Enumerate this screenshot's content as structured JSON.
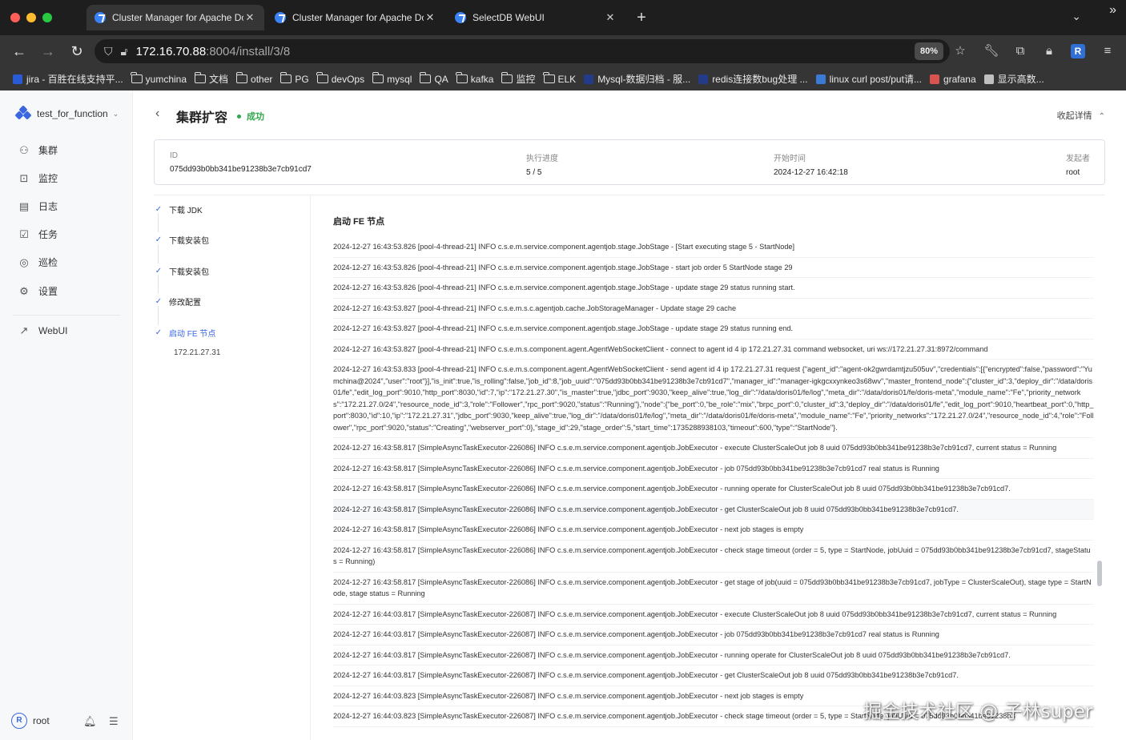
{
  "browser": {
    "tabs": [
      {
        "title": "Cluster Manager for Apache Doris",
        "active": true
      },
      {
        "title": "Cluster Manager for Apache Doris",
        "active": false
      },
      {
        "title": "SelectDB WebUI",
        "active": false
      }
    ],
    "new_tab": "+",
    "tab_menu": "⌄",
    "url_host": "172.16.70.88",
    "url_rest": ":8004/install/3/8",
    "zoom": "80%",
    "profile_initial": "R",
    "bookmarks": [
      {
        "label": "jira - 百胜在线支持平...",
        "kind": "site",
        "color": "#2a5bd7"
      },
      {
        "label": "yumchina",
        "kind": "folder"
      },
      {
        "label": "文档",
        "kind": "folder"
      },
      {
        "label": "other",
        "kind": "folder"
      },
      {
        "label": "PG",
        "kind": "folder"
      },
      {
        "label": "devOps",
        "kind": "folder"
      },
      {
        "label": "mysql",
        "kind": "folder"
      },
      {
        "label": "QA",
        "kind": "folder"
      },
      {
        "label": "kafka",
        "kind": "folder"
      },
      {
        "label": "监控",
        "kind": "folder"
      },
      {
        "label": "ELK",
        "kind": "folder"
      },
      {
        "label": "Mysql-数据归档 - 服...",
        "kind": "site",
        "color": "#243b8a"
      },
      {
        "label": "redis连接数bug处理 ...",
        "kind": "site",
        "color": "#243b8a"
      },
      {
        "label": "linux curl post/put请...",
        "kind": "site",
        "color": "#3a7bd5"
      },
      {
        "label": "grafana",
        "kind": "site",
        "color": "#d9534f"
      },
      {
        "label": "显示高数...",
        "kind": "site",
        "color": "#c0c0c0"
      }
    ],
    "bookmarks_more": "»"
  },
  "sidebar": {
    "workspace": "test_for_function",
    "items": [
      {
        "label": "集群",
        "icon": "cluster-icon",
        "glyph": "⚇"
      },
      {
        "label": "监控",
        "icon": "monitor-icon",
        "glyph": "⊡"
      },
      {
        "label": "日志",
        "icon": "log-icon",
        "glyph": "▤"
      },
      {
        "label": "任务",
        "icon": "task-icon",
        "glyph": "☑"
      },
      {
        "label": "巡检",
        "icon": "inspection-icon",
        "glyph": "◎"
      },
      {
        "label": "设置",
        "icon": "settings-icon",
        "glyph": "⚙"
      }
    ],
    "extra_item": {
      "label": "WebUI",
      "icon": "external-link-icon",
      "glyph": "↗"
    },
    "user": {
      "initial": "R",
      "name": "root"
    }
  },
  "header": {
    "title": "集群扩容",
    "status": "成功",
    "status_color": "#2ea84b",
    "collapse_label": "收起详情"
  },
  "info": {
    "id_label": "ID",
    "id_value": "075dd93b0bb341be91238b3e7cb91cd7",
    "progress_label": "执行进度",
    "progress_value": "5 / 5",
    "start_label": "开始时间",
    "start_value": "2024-12-27 16:42:18",
    "initiator_label": "发起者",
    "initiator_value": "root"
  },
  "steps": [
    {
      "label": "下载 JDK",
      "active": false
    },
    {
      "label": "下载安装包",
      "active": false
    },
    {
      "label": "下载安装包",
      "active": false
    },
    {
      "label": "修改配置",
      "active": false
    },
    {
      "label": "启动 FE 节点",
      "active": true
    }
  ],
  "step_node": "172.21.27.31",
  "log_title": "启动 FE 节点",
  "log_lines": [
    "2024-12-27 16:43:53.826 [pool-4-thread-21] INFO  c.s.e.m.service.component.agentjob.stage.JobStage - [Start executing stage 5 - StartNode]",
    "2024-12-27 16:43:53.826 [pool-4-thread-21] INFO  c.s.e.m.service.component.agentjob.stage.JobStage - start job order 5 StartNode stage 29",
    "2024-12-27 16:43:53.826 [pool-4-thread-21] INFO  c.s.e.m.service.component.agentjob.stage.JobStage - update stage 29 status running start.",
    "2024-12-27 16:43:53.827 [pool-4-thread-21] INFO  c.s.e.m.s.c.agentjob.cache.JobStorageManager - Update stage 29 cache",
    "2024-12-27 16:43:53.827 [pool-4-thread-21] INFO  c.s.e.m.service.component.agentjob.stage.JobStage - update stage 29 status running end.",
    "2024-12-27 16:43:53.827 [pool-4-thread-21] INFO  c.s.e.m.s.component.agent.AgentWebSocketClient - connect to agent id 4 ip 172.21.27.31 command websocket, uri ws://172.21.27.31:8972/command",
    "2024-12-27 16:43:53.833 [pool-4-thread-21] INFO  c.s.e.m.s.component.agent.AgentWebSocketClient - send agent id 4 ip 172.21.27.31 request {\"agent_id\":\"agent-ok2gwrdamtjzu505uv\",\"credentials\":[{\"encrypted\":false,\"password\":\"Yumchina@2024\",\"user\":\"root\"}],\"is_init\":true,\"is_rolling\":false,\"job_id\":8,\"job_uuid\":\"075dd93b0bb341be91238b3e7cb91cd7\",\"manager_id\":\"manager-igkgcxxynkeo3s68wv\",\"master_frontend_node\":{\"cluster_id\":3,\"deploy_dir\":\"/data/doris01/fe\",\"edit_log_port\":9010,\"http_port\":8030,\"id\":7,\"ip\":\"172.21.27.30\",\"is_master\":true,\"jdbc_port\":9030,\"keep_alive\":true,\"log_dir\":\"/data/doris01/fe/log\",\"meta_dir\":\"/data/doris01/fe/doris-meta\",\"module_name\":\"Fe\",\"priority_networks\":\"172.21.27.0/24\",\"resource_node_id\":3,\"role\":\"Follower\",\"rpc_port\":9020,\"status\":\"Running\"},\"node\":{\"be_port\":0,\"be_role\":\"mix\",\"brpc_port\":0,\"cluster_id\":3,\"deploy_dir\":\"/data/doris01/fe\",\"edit_log_port\":9010,\"heartbeat_port\":0,\"http_port\":8030,\"id\":10,\"ip\":\"172.21.27.31\",\"jdbc_port\":9030,\"keep_alive\":true,\"log_dir\":\"/data/doris01/fe/log\",\"meta_dir\":\"/data/doris01/fe/doris-meta\",\"module_name\":\"Fe\",\"priority_networks\":\"172.21.27.0/24\",\"resource_node_id\":4,\"role\":\"Follower\",\"rpc_port\":9020,\"status\":\"Creating\",\"webserver_port\":0},\"stage_id\":29,\"stage_order\":5,\"start_time\":1735288938103,\"timeout\":600,\"type\":\"StartNode\"}.",
    "2024-12-27 16:43:58.817 [SimpleAsyncTaskExecutor-226086] INFO  c.s.e.m.service.component.agentjob.JobExecutor - execute ClusterScaleOut job 8 uuid 075dd93b0bb341be91238b3e7cb91cd7, current status = Running",
    "2024-12-27 16:43:58.817 [SimpleAsyncTaskExecutor-226086] INFO  c.s.e.m.service.component.agentjob.JobExecutor - job 075dd93b0bb341be91238b3e7cb91cd7 real status is Running",
    "2024-12-27 16:43:58.817 [SimpleAsyncTaskExecutor-226086] INFO  c.s.e.m.service.component.agentjob.JobExecutor - running operate for ClusterScaleOut job 8 uuid 075dd93b0bb341be91238b3e7cb91cd7.",
    "2024-12-27 16:43:58.817 [SimpleAsyncTaskExecutor-226086] INFO  c.s.e.m.service.component.agentjob.JobExecutor - get ClusterScaleOut job 8 uuid 075dd93b0bb341be91238b3e7cb91cd7.",
    "2024-12-27 16:43:58.817 [SimpleAsyncTaskExecutor-226086] INFO  c.s.e.m.service.component.agentjob.JobExecutor - next job stages is empty",
    "2024-12-27 16:43:58.817 [SimpleAsyncTaskExecutor-226086] INFO  c.s.e.m.service.component.agentjob.JobExecutor - check stage timeout (order = 5, type = StartNode, jobUuid = 075dd93b0bb341be91238b3e7cb91cd7, stageStatus = Running)",
    "2024-12-27 16:43:58.817 [SimpleAsyncTaskExecutor-226086] INFO  c.s.e.m.service.component.agentjob.JobExecutor - get stage of job(uuid = 075dd93b0bb341be91238b3e7cb91cd7, jobType = ClusterScaleOut), stage type = StartNode, stage status = Running",
    "2024-12-27 16:44:03.817 [SimpleAsyncTaskExecutor-226087] INFO  c.s.e.m.service.component.agentjob.JobExecutor - execute ClusterScaleOut job 8 uuid 075dd93b0bb341be91238b3e7cb91cd7, current status = Running",
    "2024-12-27 16:44:03.817 [SimpleAsyncTaskExecutor-226087] INFO  c.s.e.m.service.component.agentjob.JobExecutor - job 075dd93b0bb341be91238b3e7cb91cd7 real status is Running",
    "2024-12-27 16:44:03.817 [SimpleAsyncTaskExecutor-226087] INFO  c.s.e.m.service.component.agentjob.JobExecutor - running operate for ClusterScaleOut job 8 uuid 075dd93b0bb341be91238b3e7cb91cd7.",
    "2024-12-27 16:44:03.817 [SimpleAsyncTaskExecutor-226087] INFO  c.s.e.m.service.component.agentjob.JobExecutor - get ClusterScaleOut job 8 uuid 075dd93b0bb341be91238b3e7cb91cd7.",
    "2024-12-27 16:44:03.823 [SimpleAsyncTaskExecutor-226087] INFO  c.s.e.m.service.component.agentjob.JobExecutor - next job stages is empty",
    "2024-12-27 16:44:03.823 [SimpleAsyncTaskExecutor-226087] INFO  c.s.e.m.service.component.agentjob.JobExecutor - check stage timeout (order = 5, type = StartNode, jobUuid = 075dd93b0bb341be91238b3"
  ],
  "watermark": "掘金技术社区 @ 子林super"
}
